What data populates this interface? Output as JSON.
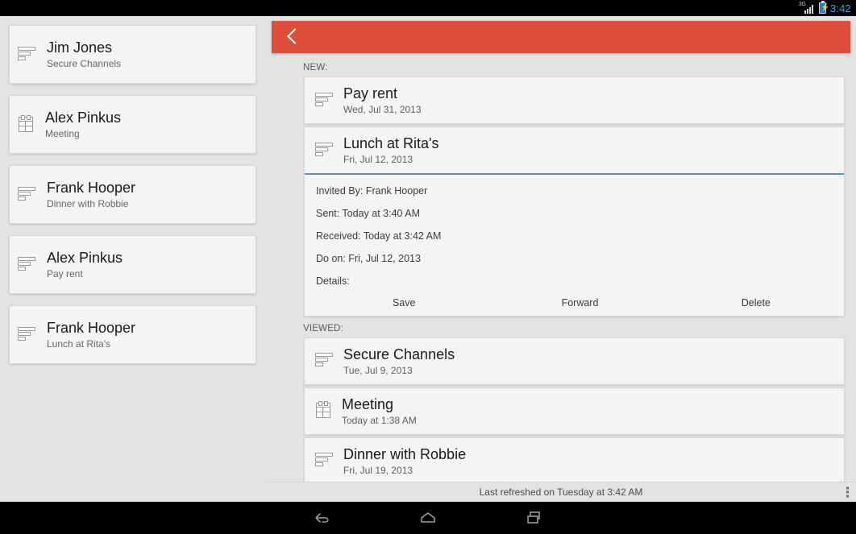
{
  "status_bar": {
    "network": "3G",
    "time": "3:42",
    "signal_icon": "signal-bars-icon",
    "battery_icon": "battery-charging-icon",
    "time_color": "#3ba7e0"
  },
  "theme": {
    "accent_red": "#df4e3a",
    "accent_blue": "#5b8fc9",
    "page_bg": "#e3e3e3",
    "card_bg": "#f4f4f4"
  },
  "sidebar": {
    "items": [
      {
        "name": "Jim Jones",
        "subject": "Secure Channels",
        "icon": "note-icon"
      },
      {
        "name": "Alex Pinkus",
        "subject": "Meeting",
        "icon": "calendar-icon"
      },
      {
        "name": "Frank Hooper",
        "subject": "Dinner with Robbie",
        "icon": "note-icon"
      },
      {
        "name": "Alex Pinkus",
        "subject": "Pay rent",
        "icon": "note-icon"
      },
      {
        "name": "Frank Hooper",
        "subject": "Lunch at Rita's",
        "icon": "note-icon"
      }
    ]
  },
  "app_bar": {
    "back_icon": "chevron-left-icon"
  },
  "main": {
    "sections": [
      {
        "label": "NEW:",
        "items": [
          {
            "title": "Pay rent",
            "date": "Wed, Jul 31, 2013",
            "icon": "note-icon",
            "expanded": false
          },
          {
            "title": "Lunch at Rita's",
            "date": "Fri, Jul 12, 2013",
            "icon": "note-icon",
            "expanded": true
          }
        ]
      },
      {
        "label": "VIEWED:",
        "items": [
          {
            "title": "Secure Channels",
            "date": "Tue, Jul 9, 2013",
            "icon": "note-icon",
            "expanded": false
          },
          {
            "title": "Meeting",
            "date": "Today at 1:38 AM",
            "icon": "calendar-icon",
            "expanded": false
          },
          {
            "title": "Dinner with Robbie",
            "date": "Fri, Jul 19, 2013",
            "icon": "note-icon",
            "expanded": false
          }
        ]
      }
    ],
    "detail": {
      "invited_by": "Invited By: Frank Hooper",
      "sent": "Sent: Today at 3:40 AM",
      "received": "Received: Today at 3:42 AM",
      "do_on": "Do on: Fri, Jul 12, 2013",
      "details": "Details:",
      "actions": {
        "save": "Save",
        "forward": "Forward",
        "delete": "Delete"
      }
    }
  },
  "footer": {
    "refresh_text": "Last refreshed on Tuesday at 3:42 AM",
    "overflow_icon": "overflow-menu-icon"
  },
  "nav_bar": {
    "back": "back-icon",
    "home": "home-icon",
    "recents": "recent-apps-icon"
  }
}
